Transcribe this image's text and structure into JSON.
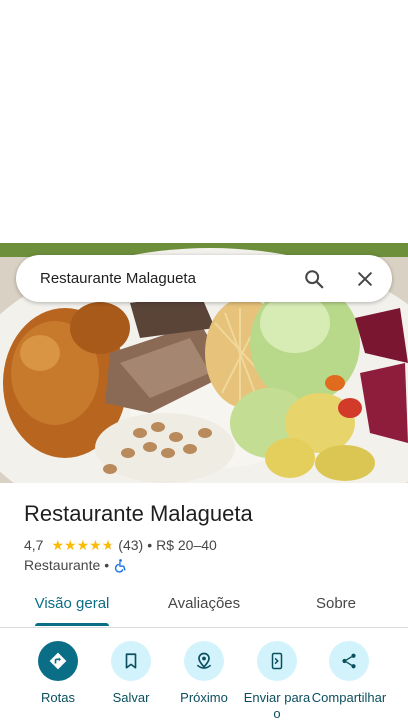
{
  "search": {
    "query": "Restaurante Malagueta"
  },
  "place": {
    "name": "Restaurante Malagueta",
    "rating": "4,7",
    "stars": 4.7,
    "reviews_count": "(43)",
    "separator": "•",
    "price_range": "R$ 20–40",
    "category": "Restaurante",
    "accessibility_icon": "wheelchair-icon"
  },
  "tabs": [
    {
      "label": "Visão geral",
      "active": true
    },
    {
      "label": "Avaliações",
      "active": false
    },
    {
      "label": "Sobre",
      "active": false
    }
  ],
  "actions": [
    {
      "label": "Rotas",
      "icon": "directions-icon",
      "primary": true
    },
    {
      "label": "Salvar",
      "icon": "bookmark-icon",
      "primary": false
    },
    {
      "label": "Próximo",
      "icon": "nearby-icon",
      "primary": false
    },
    {
      "label": "Enviar para o",
      "icon": "send-to-phone-icon",
      "primary": false
    },
    {
      "label": "Compartilhar",
      "icon": "share-icon",
      "primary": false
    }
  ],
  "colors": {
    "accent": "#0b6e87",
    "accent_light": "#d2f3fb",
    "star": "#fbbc04"
  }
}
